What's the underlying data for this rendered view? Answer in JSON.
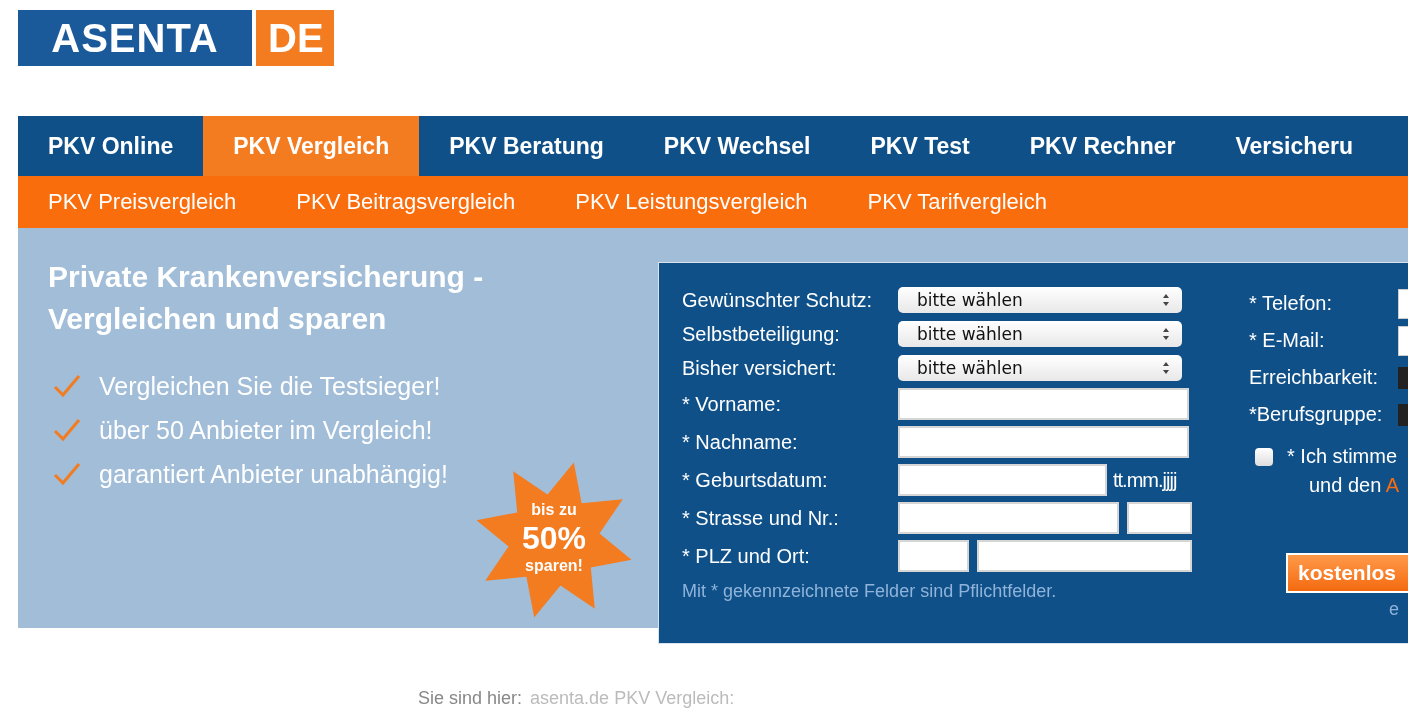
{
  "logo": {
    "name": "ASENTA",
    "suffix": "DE"
  },
  "main_nav": [
    {
      "label": "PKV Online",
      "selected": false
    },
    {
      "label": "PKV Vergleich",
      "selected": true
    },
    {
      "label": "PKV Beratung",
      "selected": false
    },
    {
      "label": "PKV Wechsel",
      "selected": false
    },
    {
      "label": "PKV Test",
      "selected": false
    },
    {
      "label": "PKV Rechner",
      "selected": false
    },
    {
      "label": "Versicheru",
      "selected": false
    }
  ],
  "sub_nav": [
    "PKV Preisvergleich",
    "PKV Beitragsvergleich",
    "PKV Leistungsvergleich",
    "PKV Tarifvergleich"
  ],
  "hero": {
    "title": [
      "Private Krankenversicherung -",
      "Vergleichen und sparen"
    ],
    "benefits": [
      "Vergleichen Sie die Testsieger!",
      "über 50 Anbieter im Vergleich!",
      "garantiert Anbieter unabhängig!"
    ],
    "badge": [
      "bis zu",
      "50%",
      "sparen!"
    ]
  },
  "form": {
    "rows": [
      {
        "kind": "select",
        "label": "Gewünschter Schutz:",
        "value": "bitte wählen"
      },
      {
        "kind": "select",
        "label": "Selbstbeteiligung:",
        "value": "bitte wählen"
      },
      {
        "kind": "select",
        "label": "Bisher versichert:",
        "value": "bitte wählen"
      },
      {
        "kind": "text",
        "label": "* Vorname:"
      },
      {
        "kind": "text",
        "label": "* Nachname:"
      },
      {
        "kind": "date",
        "label": "* Geburtsdatum:",
        "hint": "tt.mm.jjjj"
      },
      {
        "kind": "pair",
        "label": "* Strasse und Nr.:"
      },
      {
        "kind": "zip",
        "label": "* PLZ und Ort:"
      }
    ],
    "note": "Mit * gekennzeichnete Felder sind Pflichtfelder.",
    "contact_rows": [
      {
        "kind": "input",
        "label": "* Telefon:"
      },
      {
        "kind": "input",
        "label": "* E-Mail:"
      },
      {
        "kind": "select",
        "label": "Erreichbarkeit:"
      },
      {
        "kind": "select",
        "label": "*Berufsgruppe:"
      }
    ],
    "consent": {
      "checked": false,
      "line1": "* Ich stimme",
      "line2": "und den ",
      "link": "A"
    },
    "submit": "kostenlos",
    "footer_text": "e"
  },
  "breadcrumb": {
    "label": "Sie sind hier:",
    "path": "asenta.de PKV Vergleich:"
  }
}
